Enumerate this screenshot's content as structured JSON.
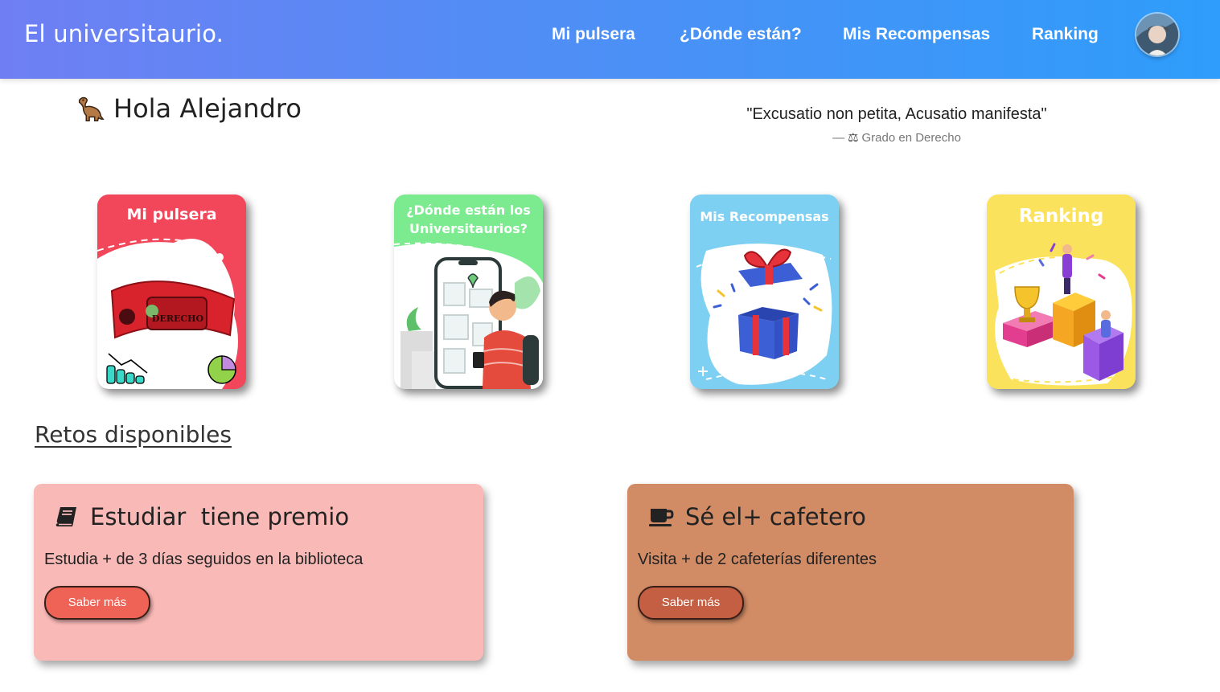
{
  "navbar": {
    "brand": "El universitaurio.",
    "links": [
      "Mi pulsera",
      "¿Dónde están?",
      "Mis Recompensas",
      "Ranking"
    ]
  },
  "greeting": {
    "text": "Hola Alejandro",
    "icon": "dinosaur-icon"
  },
  "quote": {
    "text": "\"Excusatio non petita, Acusatio manifesta\"",
    "dash": "—",
    "source": "Grado en Derecho",
    "source_icon": "scales-icon"
  },
  "feature_cards": [
    {
      "title": "Mi pulsera",
      "color": "#f2465a",
      "image": "bracelet-illustration",
      "bracelet_text": "DERECHO"
    },
    {
      "title_line1": "¿Dónde están los",
      "title_line2": "Universitaurios?",
      "color": "#7cea8e",
      "image": "phone-map-illustration"
    },
    {
      "title": "Mis Recompensas",
      "color": "#7dd0f2",
      "image": "gift-box-illustration"
    },
    {
      "title": "Ranking",
      "color": "#fbe25c",
      "image": "podium-illustration"
    }
  ],
  "challenges": {
    "section_title": "Retos disponibles",
    "items": [
      {
        "title": "Estudiar  tiene premio",
        "description": "Estudia + de 3 días seguidos en la biblioteca",
        "button": "Saber más",
        "icon": "book-icon",
        "color": "#f9b9b7",
        "button_color": "#ef6357"
      },
      {
        "title": "Sé el+ cafetero",
        "description": "Visita + de 2 cafeterías diferentes",
        "button": "Saber más",
        "icon": "coffee-cup-icon",
        "color": "#d18b65",
        "button_color": "#c45f43"
      }
    ]
  }
}
